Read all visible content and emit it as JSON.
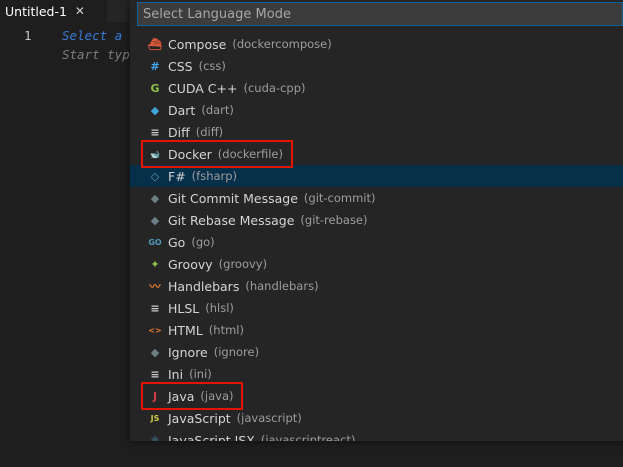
{
  "tab": {
    "title": "Untitled-1",
    "close": "✕"
  },
  "editor": {
    "line_number": "1",
    "hint_line1": "Select a",
    "hint_line2": "Start typ"
  },
  "quick_pick": {
    "placeholder": "Select Language Mode",
    "items": [
      {
        "label": "Compose",
        "id": "(dockercompose)",
        "icon": "docker-compose-icon",
        "glyph": "⛴",
        "color": "#e05a3a"
      },
      {
        "label": "CSS",
        "id": "(css)",
        "icon": "css-icon",
        "glyph": "#",
        "color": "#42a5f5"
      },
      {
        "label": "CUDA C++",
        "id": "(cuda-cpp)",
        "icon": "cuda-icon",
        "glyph": "G",
        "color": "#8bc34a"
      },
      {
        "label": "Dart",
        "id": "(dart)",
        "icon": "dart-icon",
        "glyph": "◆",
        "color": "#40a4d8"
      },
      {
        "label": "Diff",
        "id": "(diff)",
        "icon": "text-icon",
        "glyph": "≡",
        "color": "#cccccc"
      },
      {
        "label": "Docker",
        "id": "(dockerfile)",
        "icon": "docker-icon",
        "glyph": "🐋",
        "color": "#519aba"
      },
      {
        "label": "F#",
        "id": "(fsharp)",
        "icon": "fsharp-icon",
        "glyph": "◇",
        "color": "#519aba"
      },
      {
        "label": "Git Commit Message",
        "id": "(git-commit)",
        "icon": "git-icon",
        "glyph": "◆",
        "color": "#6d8086"
      },
      {
        "label": "Git Rebase Message",
        "id": "(git-rebase)",
        "icon": "git-icon",
        "glyph": "◆",
        "color": "#6d8086"
      },
      {
        "label": "Go",
        "id": "(go)",
        "icon": "go-icon",
        "glyph": "GO",
        "color": "#519aba"
      },
      {
        "label": "Groovy",
        "id": "(groovy)",
        "icon": "groovy-icon",
        "glyph": "✦",
        "color": "#8dc149"
      },
      {
        "label": "Handlebars",
        "id": "(handlebars)",
        "icon": "handlebars-icon",
        "glyph": "〰",
        "color": "#e37933"
      },
      {
        "label": "HLSL",
        "id": "(hlsl)",
        "icon": "text-icon",
        "glyph": "≡",
        "color": "#cccccc"
      },
      {
        "label": "HTML",
        "id": "(html)",
        "icon": "html-icon",
        "glyph": "<>",
        "color": "#e37933"
      },
      {
        "label": "Ignore",
        "id": "(ignore)",
        "icon": "git-icon",
        "glyph": "◆",
        "color": "#6d8086"
      },
      {
        "label": "Ini",
        "id": "(ini)",
        "icon": "text-icon",
        "glyph": "≡",
        "color": "#cccccc"
      },
      {
        "label": "Java",
        "id": "(java)",
        "icon": "java-icon",
        "glyph": "J",
        "color": "#cc3e44"
      },
      {
        "label": "JavaScript",
        "id": "(javascript)",
        "icon": "javascript-icon",
        "glyph": "JS",
        "color": "#cbcb41"
      },
      {
        "label": "JavaScript JSX",
        "id": "(javascriptreact)",
        "icon": "react-icon",
        "glyph": "⚛",
        "color": "#519aba"
      }
    ],
    "highlighted": [
      "Docker",
      "Java"
    ]
  },
  "colors": {
    "background": "#1e1e1e",
    "panel": "#252526",
    "input_border": "#0e639c",
    "selected_row": "#062f4a",
    "annotation_box": "#e51400"
  }
}
